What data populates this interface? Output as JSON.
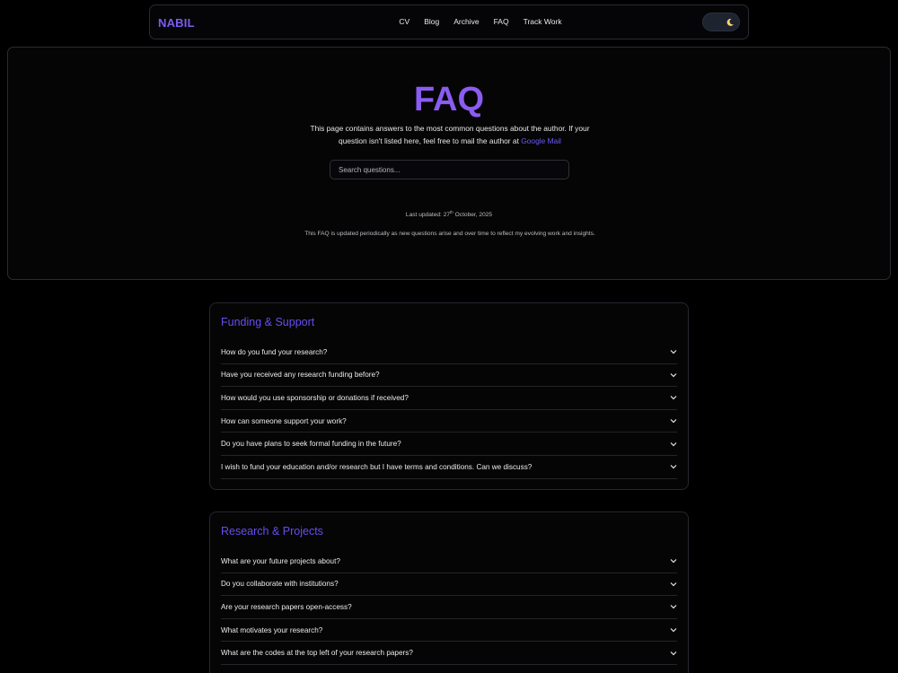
{
  "nav": {
    "brand": "NABIL",
    "links": [
      "CV",
      "Blog",
      "Archive",
      "FAQ",
      "Track Work"
    ],
    "theme_toggle_icon": "moon-icon"
  },
  "hero": {
    "title": "FAQ",
    "description": "This page contains answers to the most common questions about the author. If your question isn't listed here, feel free to mail the author at",
    "mail_link": "Google Mail",
    "search_placeholder": "Search questions...",
    "updated_prefix": "Last updated: 27",
    "updated_sup": "th",
    "updated_suffix": " October, 2025",
    "note": "This FAQ is updated periodically as new questions arise and over time to reflect my evolving work and insights."
  },
  "sections": [
    {
      "title": "Funding & Support",
      "questions": [
        "How do you fund your research?",
        "Have you received any research funding before?",
        "How would you use sponsorship or donations if received?",
        "How can someone support your work?",
        "Do you have plans to seek formal funding in the future?",
        "I wish to fund your education and/or research but I have terms and conditions. Can we discuss?"
      ]
    },
    {
      "title": "Research & Projects",
      "questions": [
        "What are your future projects about?",
        "Do you collaborate with institutions?",
        "Are your research papers open-access?",
        "What motivates your research?",
        "What are the codes at the top left of your research papers?"
      ]
    }
  ],
  "colors": {
    "accent": "#7c5cf0",
    "background": "#000000",
    "border": "#2a2a33"
  }
}
